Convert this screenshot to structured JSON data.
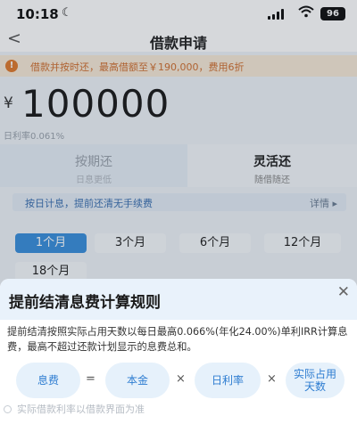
{
  "status_bar": {
    "time": "10:18",
    "battery": "96"
  },
  "nav": {
    "title": "借款申请"
  },
  "notice": {
    "text": "借款并按时还，最高借额至￥190,000，费用6折"
  },
  "loan": {
    "currency": "¥",
    "amount": "100000",
    "daily_rate": "日利率0.061%"
  },
  "modes": [
    {
      "name": "按期还",
      "sub": "日息更低"
    },
    {
      "name": "灵活还",
      "sub": "随借随还"
    }
  ],
  "flex_tip": {
    "text": "按日计息，提前还清无手续费",
    "detail": "详情 ▸"
  },
  "terms": [
    "1个月",
    "3个月",
    "6个月",
    "12个月",
    "18个月"
  ],
  "sheet": {
    "title": "提前结清息费计算规则",
    "close": "✕",
    "description": "提前结清按照实际占用天数以每日最高0.066%(年化24.00%)单利IRR计算息费，最高不超过还款计划显示的息费总和。",
    "formula": {
      "fee": "息费",
      "equals": "=",
      "principal": "本金",
      "times": "×",
      "rate": "日利率",
      "days": "实际占用天数"
    },
    "footnote": "实际借款利率以借款界面为准"
  },
  "colors": {
    "accent": "#3a8fdc",
    "sheet_header": "#e9f2fb",
    "notice_text": "#d07030"
  }
}
